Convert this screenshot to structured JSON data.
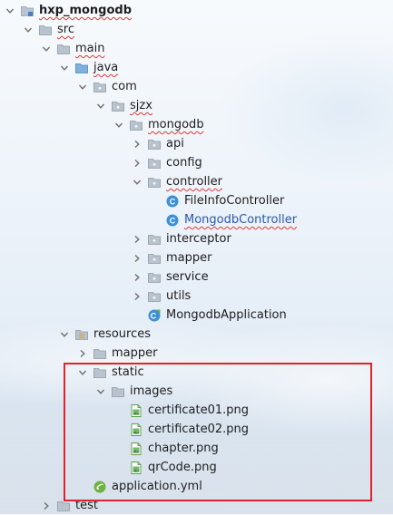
{
  "colors": {
    "highlight": "#e0222a",
    "folder": "#a9b7c6",
    "class_icon": "#3d8fd6",
    "link_text": "#2957b5"
  },
  "tree": [
    {
      "label": "hxp_mongodb",
      "arrow": "down",
      "icon": "module-folder-icon",
      "bold": true,
      "squiggle": true
    },
    {
      "label": "src",
      "arrow": "down",
      "icon": "folder-icon",
      "squiggle": true
    },
    {
      "label": "main",
      "arrow": "down",
      "icon": "folder-icon",
      "squiggle": true
    },
    {
      "label": "java",
      "arrow": "down",
      "icon": "source-folder-icon",
      "squiggle": true
    },
    {
      "label": "com",
      "arrow": "down",
      "icon": "package-icon"
    },
    {
      "label": "sjzx",
      "arrow": "down",
      "icon": "package-icon",
      "squiggle": true
    },
    {
      "label": "mongodb",
      "arrow": "down",
      "icon": "package-icon",
      "squiggle": true
    },
    {
      "label": "api",
      "arrow": "right",
      "icon": "package-icon"
    },
    {
      "label": "config",
      "arrow": "right",
      "icon": "package-icon"
    },
    {
      "label": "controller",
      "arrow": "down",
      "icon": "package-icon",
      "squiggle": true
    },
    {
      "label": "FileInfoController",
      "arrow": "none",
      "icon": "class-icon"
    },
    {
      "label": "MongodbController",
      "arrow": "none",
      "icon": "class-icon",
      "blue": true,
      "squiggle": true
    },
    {
      "label": "interceptor",
      "arrow": "right",
      "icon": "package-icon"
    },
    {
      "label": "mapper",
      "arrow": "right",
      "icon": "package-icon"
    },
    {
      "label": "service",
      "arrow": "right",
      "icon": "package-icon"
    },
    {
      "label": "utils",
      "arrow": "right",
      "icon": "package-icon"
    },
    {
      "label": "MongodbApplication",
      "arrow": "none",
      "icon": "spring-class-icon"
    },
    {
      "label": "resources",
      "arrow": "down",
      "icon": "resources-folder-icon"
    },
    {
      "label": "mapper",
      "arrow": "right",
      "icon": "folder-icon"
    },
    {
      "label": "static",
      "arrow": "down",
      "icon": "folder-icon"
    },
    {
      "label": "images",
      "arrow": "down",
      "icon": "folder-icon"
    },
    {
      "label": "certificate01.png",
      "arrow": "none",
      "icon": "image-file-icon"
    },
    {
      "label": "certificate02.png",
      "arrow": "none",
      "icon": "image-file-icon"
    },
    {
      "label": "chapter.png",
      "arrow": "none",
      "icon": "image-file-icon"
    },
    {
      "label": "qrCode.png",
      "arrow": "none",
      "icon": "image-file-icon"
    },
    {
      "label": "application.yml",
      "arrow": "none",
      "icon": "yaml-file-icon"
    },
    {
      "label": "test",
      "arrow": "right",
      "icon": "folder-icon"
    }
  ]
}
